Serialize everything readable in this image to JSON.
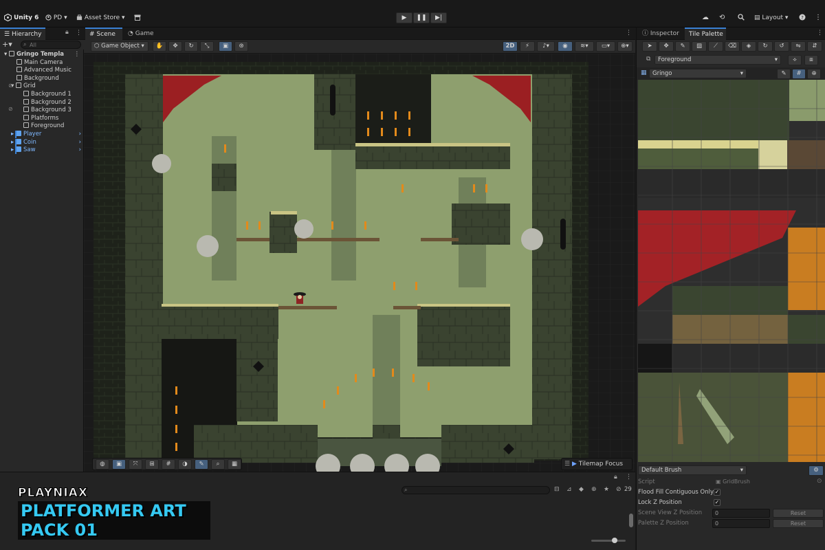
{
  "topbar": {
    "app_name": "Unity 6",
    "account": "PD",
    "asset_store": "Asset Store",
    "layout": "Layout",
    "colors": {
      "bg": "#191919",
      "accent": "#3b82d6"
    }
  },
  "hierarchy": {
    "tab_label": "Hierarchy",
    "search_placeholder": "All",
    "items": [
      {
        "label": "Gringo Templa",
        "depth": 0,
        "type": "scene"
      },
      {
        "label": "Main Camera",
        "depth": 1,
        "type": "object"
      },
      {
        "label": "Advanced Music",
        "depth": 1,
        "type": "object"
      },
      {
        "label": "Background",
        "depth": 1,
        "type": "object"
      },
      {
        "label": "Grid",
        "depth": 1,
        "type": "object"
      },
      {
        "label": "Background 1",
        "depth": 2,
        "type": "object"
      },
      {
        "label": "Background 2",
        "depth": 2,
        "type": "object"
      },
      {
        "label": "Background 3",
        "depth": 2,
        "type": "object"
      },
      {
        "label": "Platforms",
        "depth": 2,
        "type": "object"
      },
      {
        "label": "Foreground",
        "depth": 2,
        "type": "object"
      },
      {
        "label": "Player",
        "depth": 1,
        "type": "prefab"
      },
      {
        "label": "Coin",
        "depth": 1,
        "type": "prefab"
      },
      {
        "label": "Saw",
        "depth": 1,
        "type": "prefab"
      }
    ]
  },
  "scene": {
    "tabs": [
      "Scene",
      "Game"
    ],
    "active_tab": "Scene",
    "tool_context": "Game Object",
    "mode_2d": "2D",
    "overlay_label": "Tilemap Focus"
  },
  "inspector": {
    "tabs": [
      "Inspector",
      "Tile Palette"
    ],
    "active_tab": "Tile Palette",
    "target_tilemap": "Foreground",
    "palette": "Gringo",
    "brush": "Default Brush",
    "properties": {
      "script_label": "Script",
      "script_value": "GridBrush",
      "flood_fill_label": "Flood Fill Contiguous Only",
      "lock_z_label": "Lock Z Position",
      "scene_z_label": "Scene View Z Position",
      "scene_z_value": "0",
      "palette_z_label": "Palette Z Position",
      "palette_z_value": "0",
      "reset_label": "Reset"
    }
  },
  "bottom_panel": {
    "item_count": "29"
  },
  "branding": {
    "line1": "PLAYNIAX",
    "line2": "PLATFORMER ART PACK 01"
  }
}
